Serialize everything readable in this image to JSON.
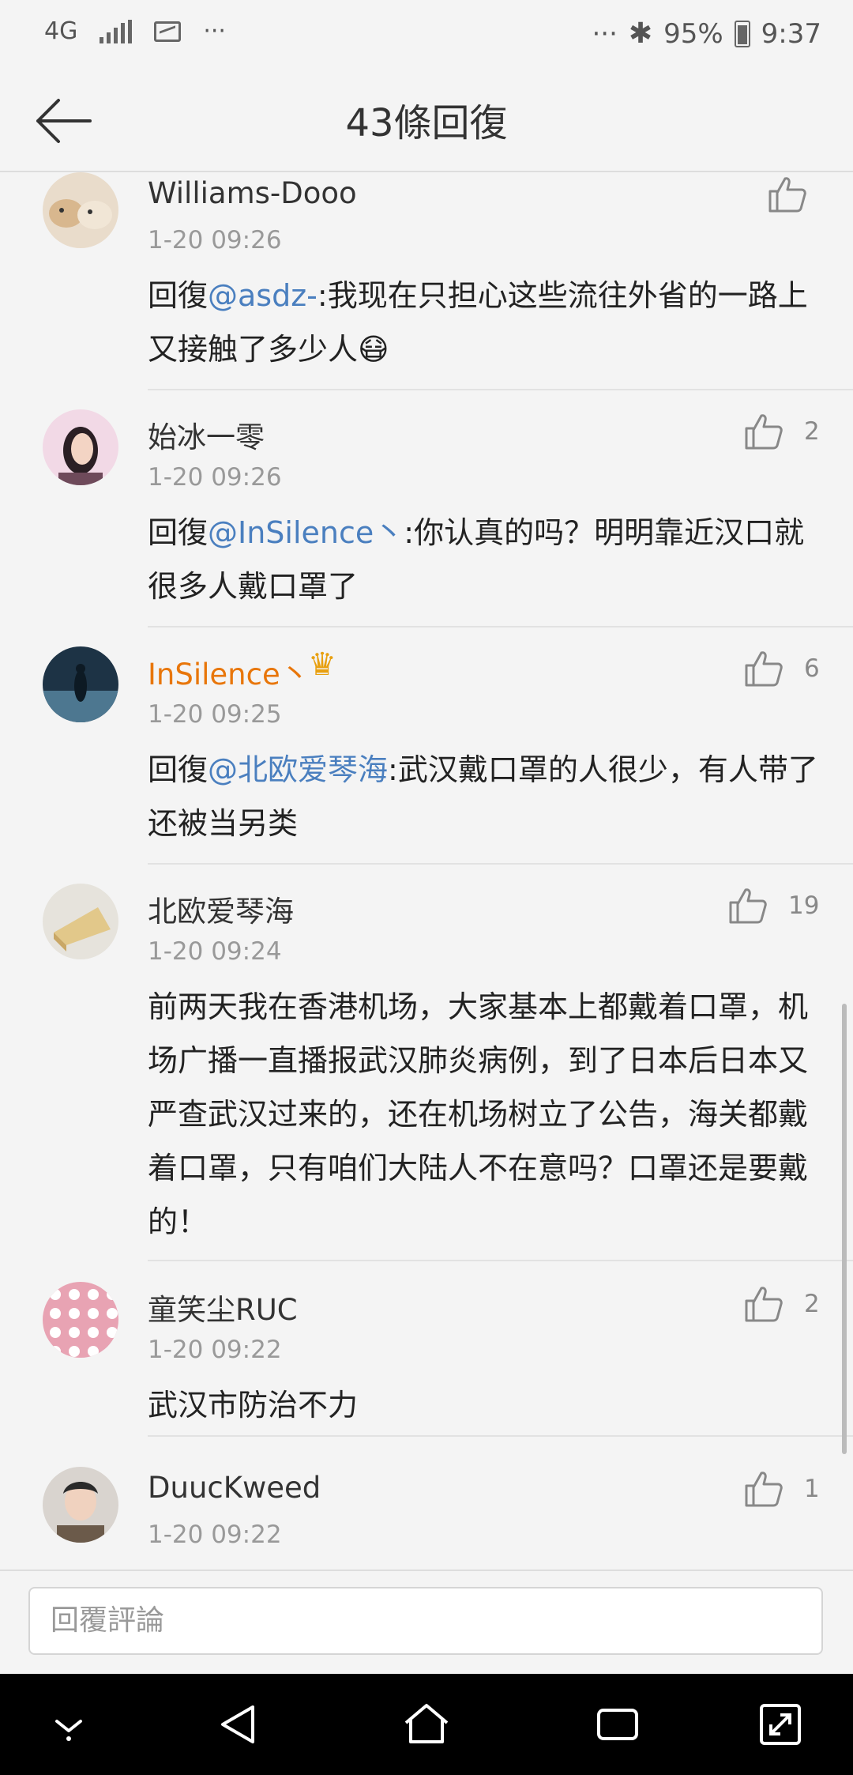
{
  "status_bar": {
    "network": "4G",
    "more_left": "···",
    "more_right": "···",
    "battery_percent": "95%",
    "time": "9:37"
  },
  "header": {
    "title": "43條回復"
  },
  "comments": [
    {
      "name": "Williams-Dooo",
      "time": "1-20 09:26",
      "likes": "",
      "reply_prefix": "回復",
      "mention": "@asdz-",
      "text": ":我现在只担心这些流往外省的一路上又接触了多少人😷"
    },
    {
      "name": "始冰一零",
      "time": "1-20 09:26",
      "likes": "2",
      "reply_prefix": "回復",
      "mention": "@InSilence丶",
      "text": ":你认真的吗？明明靠近汉口就很多人戴口罩了"
    },
    {
      "name": "InSilence丶",
      "vip": true,
      "time": "1-20 09:25",
      "likes": "6",
      "reply_prefix": "回復",
      "mention": "@北欧爱琴海",
      "text": ":武汉戴口罩的人很少，有人带了还被当另类"
    },
    {
      "name": "北欧爱琴海",
      "time": "1-20 09:24",
      "likes": "19",
      "reply_prefix": "",
      "mention": "",
      "text": "前两天我在香港机场，大家基本上都戴着口罩，机场广播一直播报武汉肺炎病例，到了日本后日本又严查武汉过来的，还在机场树立了公告，海关都戴着口罩，只有咱们大陆人不在意吗？口罩还是要戴的！"
    },
    {
      "name": "童笑尘RUC",
      "time": "1-20 09:22",
      "likes": "2",
      "reply_prefix": "",
      "mention": "",
      "text": "武汉市防治不力"
    },
    {
      "name": "DuucKweed",
      "time": "1-20 09:22",
      "likes": "1",
      "reply_prefix": "",
      "mention": "",
      "text": ""
    }
  ],
  "reply_bar": {
    "placeholder": "回覆評論"
  },
  "colors": {
    "mention": "#4a7fbf",
    "vip_name": "#e8760a",
    "background": "#f4f4f4"
  },
  "icons": {
    "back": "arrow-left-icon",
    "like": "thumbs-up-icon",
    "vip": "crown-icon",
    "nav": [
      "chevron-down-icon",
      "back-triangle-icon",
      "home-icon",
      "recents-icon",
      "expand-icon"
    ]
  }
}
